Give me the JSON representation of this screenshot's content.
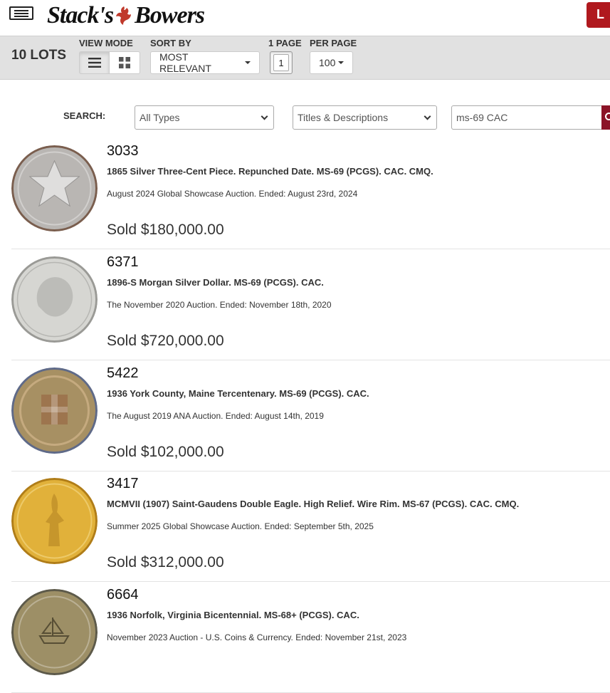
{
  "header": {
    "logo_text_1": "Stack's",
    "logo_text_2": "Bowers",
    "right_button_label": "L"
  },
  "toolbar": {
    "lots_count": "10 LOTS",
    "view_mode_label": "VIEW MODE",
    "sort_by_label": "SORT BY",
    "sort_value": "MOST RELEVANT",
    "page_label": "1 PAGE",
    "page_value": "1",
    "per_page_label": "PER PAGE",
    "per_page_value": "100"
  },
  "search": {
    "label": "SEARCH:",
    "type_value": "All Types",
    "scope_value": "Titles & Descriptions",
    "query": "ms-69 CAC"
  },
  "lots": [
    {
      "number": "3033",
      "title": "1865 Silver Three-Cent Piece. Repunched Date. MS-69 (PCGS). CAC. CMQ.",
      "auction": "August 2024 Global Showcase Auction. Ended: August 23rd, 2024",
      "sold": "Sold $180,000.00",
      "coin_color": "#b9b6b3",
      "coin_edge": "#7a5e4e"
    },
    {
      "number": "6371",
      "title": "1896-S Morgan Silver Dollar. MS-69 (PCGS). CAC.",
      "auction": "The November 2020 Auction. Ended: November 18th, 2020",
      "sold": "Sold $720,000.00",
      "coin_color": "#d6d6d2",
      "coin_edge": "#9a9a96"
    },
    {
      "number": "5422",
      "title": "1936 York County, Maine Tercentenary. MS-69 (PCGS). CAC.",
      "auction": "The August 2019 ANA Auction. Ended: August 14th, 2019",
      "sold": "Sold $102,000.00",
      "coin_color": "#a79063",
      "coin_edge": "#5f6a88"
    },
    {
      "number": "3417",
      "title": "MCMVII (1907) Saint-Gaudens Double Eagle. High Relief. Wire Rim. MS-67 (PCGS). CAC. CMQ.",
      "auction": "Summer 2025 Global Showcase Auction. Ended: September 5th, 2025",
      "sold": "Sold $312,000.00",
      "coin_color": "#e1b13a",
      "coin_edge": "#b07d18"
    },
    {
      "number": "6664",
      "title": "1936 Norfolk, Virginia Bicentennial. MS-68+ (PCGS). CAC.",
      "auction": "November 2023 Auction - U.S. Coins & Currency. Ended: November 21st, 2023",
      "sold": "",
      "coin_color": "#9d8f66",
      "coin_edge": "#5d5a4a"
    }
  ],
  "colors": {
    "brand_red": "#b0191e",
    "search_button": "#8b1327",
    "toolbar_bg": "#e1e1e1"
  }
}
